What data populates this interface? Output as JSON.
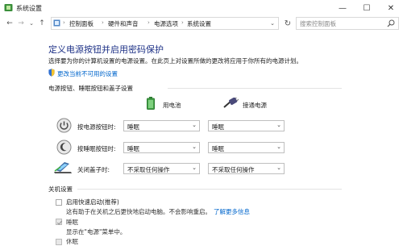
{
  "window": {
    "title": "系统设置",
    "minimize_glyph": "—",
    "maximize_glyph": "☐",
    "close_glyph": "✕"
  },
  "nav": {
    "back_glyph": "←",
    "forward_glyph": "→",
    "recent_glyph": "⌄",
    "up_glyph": "↑",
    "dropdown_glyph": "⌄",
    "refresh_glyph": "↻",
    "separator_glyph": "›",
    "breadcrumbs": [
      "控制面板",
      "硬件和声音",
      "电源选项",
      "系统设置"
    ],
    "search_placeholder": "搜索控制面板"
  },
  "main": {
    "title": "定义电源按钮并启用密码保护",
    "description": "选择要为你的计算机设置的电源设置。在此页上对设置所做的更改将应用于你所有的电源计划。",
    "change_link": "更改当前不可用的设置"
  },
  "power_section": {
    "title": "电源按钮、睡眠按钮和盖子设置",
    "battery_label": "用电池",
    "plugged_label": "接通电源",
    "rows": [
      {
        "label": "按电源按钮时:",
        "battery": "睡眠",
        "plugged": "睡眠"
      },
      {
        "label": "按睡眠按钮时:",
        "battery": "睡眠",
        "plugged": "睡眠"
      },
      {
        "label": "关闭盖子时:",
        "battery": "不采取任何操作",
        "plugged": "不采取任何操作"
      }
    ],
    "arrow_glyph": "⌄"
  },
  "shutdown_section": {
    "title": "关机设置",
    "fast_startup_label": "启用快速启动(推荐)",
    "fast_startup_desc": "这有助于在关机之后更快地启动电脑。不会影响重启。",
    "learn_more": "了解更多信息",
    "sleep_label": "睡眠",
    "sleep_desc": "显示在\"电源\"菜单中。",
    "hibernate_label": "休眠"
  },
  "colors": {
    "title_blue": "#1e3287",
    "link_blue": "#0066cc"
  }
}
